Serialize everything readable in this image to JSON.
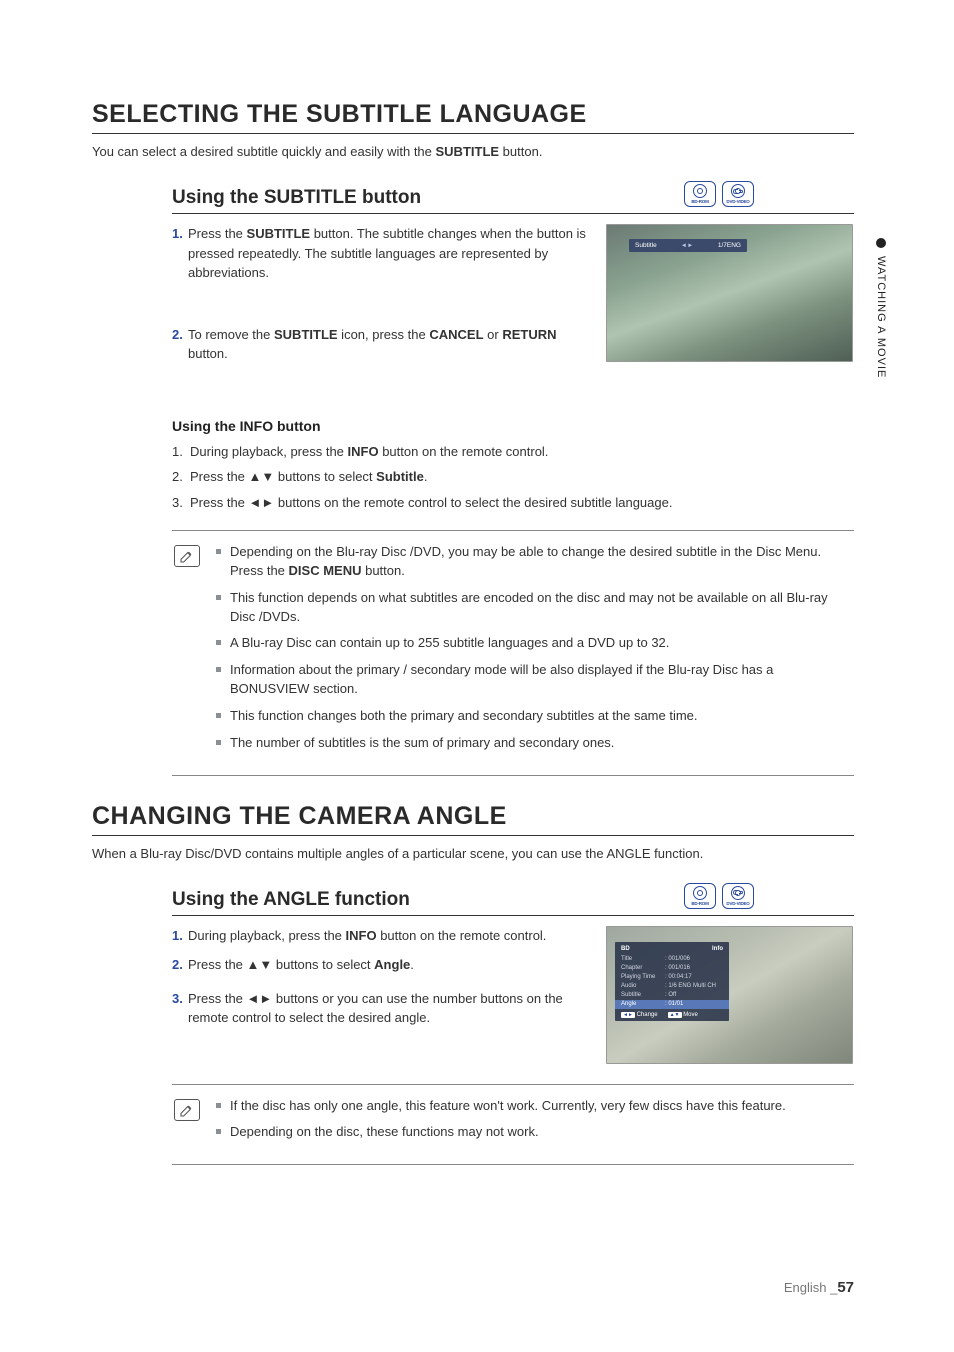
{
  "sideTab": "WATCHING A MOVIE",
  "section1": {
    "title": "SELECTING THE SUBTITLE LANGUAGE",
    "intro_pre": "You can select a desired subtitle quickly and easily with the ",
    "intro_bold": "SUBTITLE",
    "intro_post": " button.",
    "sub_title": "Using the SUBTITLE button",
    "discs": {
      "bd": "BD-ROM",
      "dvd": "DVD-VIDEO"
    },
    "steps": [
      {
        "n": "1.",
        "pre": "Press the ",
        "b1": "SUBTITLE",
        "post1": " button. The subtitle changes when the button is pressed repeatedly. The subtitle languages are represented by abbreviations."
      },
      {
        "n": "2.",
        "pre": "To remove the ",
        "b1": "SUBTITLE",
        "mid": " icon, press the ",
        "b2": "CANCEL",
        "mid2": " or ",
        "b3": "RETURN",
        "post": " button."
      }
    ],
    "shot1": {
      "label": "Subtitle",
      "arrows": "◄►",
      "value": "1/7ENG"
    },
    "info_heading": "Using the INFO button",
    "info_steps": [
      {
        "n": "1.",
        "pre": "During playback, press the ",
        "b": "INFO",
        "post": " button on the remote control."
      },
      {
        "n": "2.",
        "pre": "Press the ",
        "arr": "▲▼",
        "mid": " buttons to select ",
        "b": "Subtitle",
        "post": "."
      },
      {
        "n": "3.",
        "pre": "Press the ",
        "arr": "◄►",
        "post": " buttons on the remote control to select the desired subtitle language."
      }
    ],
    "notes": [
      {
        "pre": "Depending on the Blu-ray Disc /DVD, you may be able to change the desired subtitle in the Disc Menu. Press the ",
        "b": "DISC MENU",
        "post": " button."
      },
      {
        "text": "This function depends on what subtitles are encoded on the disc and may not be available on all Blu-ray Disc /DVDs."
      },
      {
        "text": "A Blu-ray Disc can contain up to 255 subtitle languages and a DVD up to 32."
      },
      {
        "text": "Information about the primary / secondary mode will be also displayed if the Blu-ray Disc has a BONUSVIEW section."
      },
      {
        "text": "This function changes both the primary and secondary subtitles at the same time."
      },
      {
        "text": "The number of subtitles is the sum of primary and secondary ones."
      }
    ]
  },
  "section2": {
    "title": "CHANGING THE CAMERA ANGLE",
    "intro": "When a Blu-ray Disc/DVD contains multiple angles of a particular scene, you can use the ANGLE function.",
    "sub_title": "Using the ANGLE function",
    "discs": {
      "bd": "BD-ROM",
      "dvd": "DVD-VIDEO"
    },
    "steps": [
      {
        "n": "1.",
        "pre": "During playback, press the ",
        "b": "INFO",
        "post": " button on the remote control."
      },
      {
        "n": "2.",
        "pre": "Press the ",
        "arr": "▲▼",
        "mid": " buttons to select ",
        "b": "Angle",
        "post": "."
      },
      {
        "n": "3.",
        "pre": "Press the ",
        "arr": "◄►",
        "post": " buttons or you can use the number buttons on the remote control to select the desired angle."
      }
    ],
    "shot2": {
      "hdr_left": "BD",
      "hdr_right": "Info",
      "rows": [
        {
          "k": "Title",
          "v": ": 001/006"
        },
        {
          "k": "Chapter",
          "v": ": 001/016"
        },
        {
          "k": "Playing Time",
          "v": ": 00:04:17"
        },
        {
          "k": "Audio",
          "v": ": 1/6 ENG Multi CH"
        },
        {
          "k": "Subtitle",
          "v": ": Off"
        },
        {
          "k": "Angle",
          "v": ": 01/01",
          "sel": true
        }
      ],
      "ftr_change_icon": "◄►",
      "ftr_change": "Change",
      "ftr_move_icon": "▲▼",
      "ftr_move": "Move"
    },
    "notes": [
      {
        "text": "If the disc has only one angle, this feature won't work. Currently, very few discs have this feature."
      },
      {
        "text": "Depending on the disc, these functions may not work."
      }
    ]
  },
  "footer": {
    "lang": "English ",
    "sep": "_",
    "page": "57"
  }
}
